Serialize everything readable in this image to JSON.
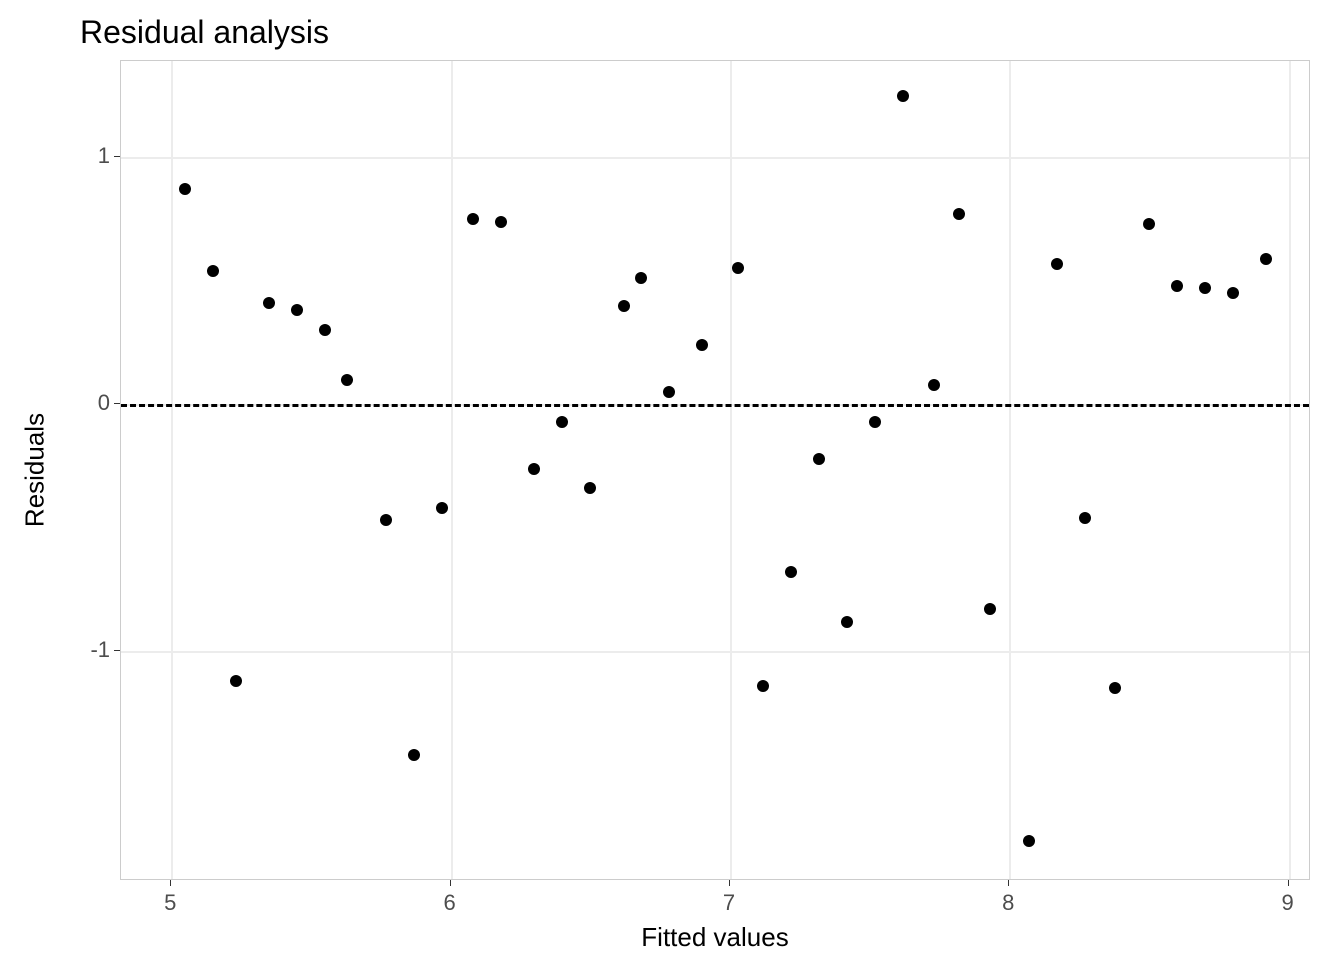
{
  "chart_data": {
    "type": "scatter",
    "title": "Residual analysis",
    "xlabel": "Fitted values",
    "ylabel": "Residuals",
    "xlim": [
      4.82,
      9.08
    ],
    "ylim": [
      -1.93,
      1.39
    ],
    "x_ticks": [
      5,
      6,
      7,
      8,
      9
    ],
    "y_ticks": [
      -1,
      0,
      1
    ],
    "hline": 0,
    "x": [
      5.05,
      5.15,
      5.23,
      5.35,
      5.45,
      5.55,
      5.63,
      5.77,
      5.87,
      5.97,
      6.08,
      6.18,
      6.3,
      6.4,
      6.5,
      6.62,
      6.68,
      6.78,
      6.9,
      7.03,
      7.12,
      7.22,
      7.32,
      7.42,
      7.52,
      7.62,
      7.73,
      7.82,
      7.93,
      8.07,
      8.17,
      8.27,
      8.38,
      8.5,
      8.6,
      8.7,
      8.8,
      8.92
    ],
    "y": [
      0.87,
      0.54,
      -1.12,
      0.41,
      0.38,
      0.3,
      0.1,
      -0.47,
      -1.42,
      -0.42,
      0.75,
      0.74,
      -0.26,
      -0.07,
      -0.34,
      0.4,
      0.51,
      0.05,
      0.24,
      0.55,
      -1.14,
      -0.68,
      -0.22,
      -0.88,
      -0.07,
      1.25,
      0.08,
      0.77,
      -0.83,
      -1.77,
      0.57,
      -0.46,
      -1.15,
      0.73,
      0.48,
      0.47,
      0.45,
      0.59
    ]
  }
}
